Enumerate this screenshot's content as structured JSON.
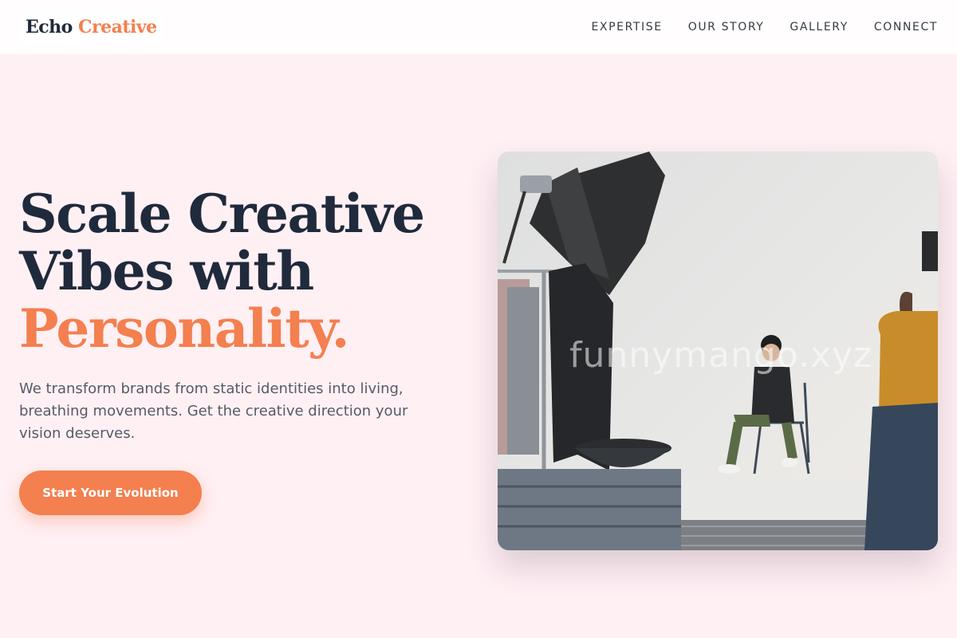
{
  "brand": {
    "name_part1": "Echo",
    "name_part2": "Creative"
  },
  "nav": {
    "items": [
      {
        "label": "EXPERTISE"
      },
      {
        "label": "OUR STORY"
      },
      {
        "label": "GALLERY"
      },
      {
        "label": "CONNECT"
      }
    ]
  },
  "hero": {
    "title_line1": "Scale Creative",
    "title_line2": "Vibes with",
    "title_accent": "Personality.",
    "description": "We transform brands from static identities into living, breathing movements. Get the creative direction your vision deserves.",
    "cta_label": "Start Your Evolution",
    "watermark": "funnymango.xyz"
  },
  "colors": {
    "accent": "#f47f4f",
    "dark": "#1f2a3c",
    "background": "#fff0f4"
  },
  "icons": {}
}
